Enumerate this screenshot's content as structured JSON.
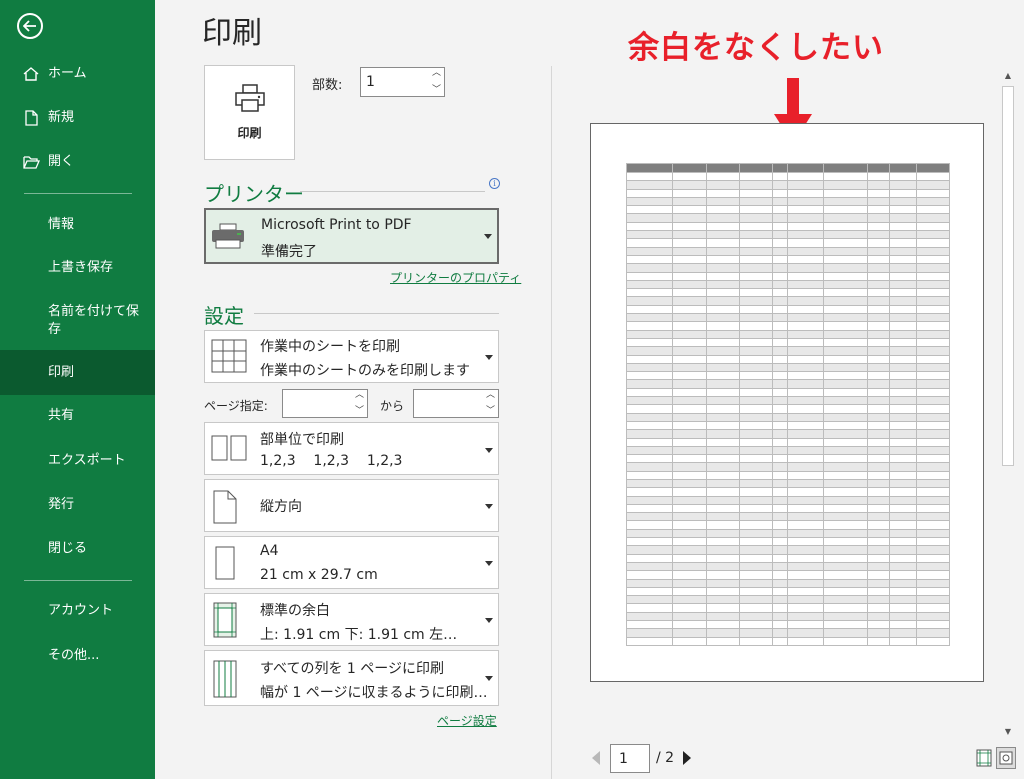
{
  "sidebar": {
    "home": "ホーム",
    "new": "新規",
    "open": "開く",
    "info": "情報",
    "save": "上書き保存",
    "save_as": "名前を付けて保\n存",
    "print": "印刷",
    "share": "共有",
    "export": "エクスポート",
    "publish": "発行",
    "close": "閉じる",
    "account": "アカウント",
    "more": "その他..."
  },
  "main": {
    "title": "印刷",
    "print_button": "印刷",
    "copies_label": "部数:",
    "copies_value": "1"
  },
  "printer": {
    "heading": "プリンター",
    "name": "Microsoft Print to PDF",
    "status": "準備完了",
    "properties_link": "プリンターのプロパティ"
  },
  "settings": {
    "heading": "設定",
    "scope_main": "作業中のシートを印刷",
    "scope_sub": "作業中のシートのみを印刷します",
    "pages_label": "ページ指定:",
    "pages_to": "から",
    "collate_main": "部単位で印刷",
    "collate_sub": "1,2,3    1,2,3    1,2,3",
    "orientation": "縦方向",
    "paper_main": "A4",
    "paper_sub": "21 cm x 29.7 cm",
    "margins_main": "標準の余白",
    "margins_sub": "上: 1.91 cm 下: 1.91 cm 左…",
    "scaling_main": "すべての列を 1 ページに印刷",
    "scaling_sub": "幅が 1 ページに収まるように印刷…",
    "page_setup_link": "ページ設定"
  },
  "preview": {
    "annotation": "余白をなくしたい",
    "current_page": "1",
    "total_pages": "/ 2",
    "colors": {
      "accent": "#107c41",
      "annotation": "#e8202a"
    }
  },
  "icons": [
    "back-arrow-icon",
    "home-icon",
    "new-document-icon",
    "open-folder-icon",
    "printer-icon",
    "info-icon",
    "sheet-grid-icon",
    "collate-icon",
    "portrait-page-icon",
    "paper-size-icon",
    "margins-icon",
    "scaling-icon",
    "show-margins-icon",
    "zoom-to-page-icon"
  ]
}
